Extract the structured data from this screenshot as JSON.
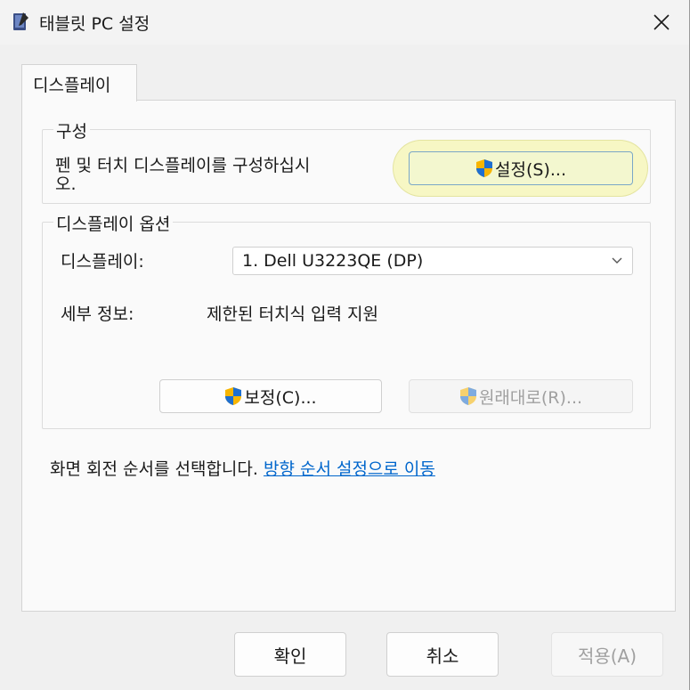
{
  "window": {
    "title": "태블릿 PC 설정",
    "icon": "tablet-pc-icon"
  },
  "tabs": [
    {
      "label": "디스플레이",
      "selected": true
    }
  ],
  "configure_group": {
    "label": "구성",
    "description_line1": "펜 및 터치 디스플레이를 구성하십시",
    "description_line2": "오.",
    "setup_button": {
      "label": "설정(S)...",
      "icon": "uac-shield-icon",
      "highlighted": true
    }
  },
  "display_options_group": {
    "label": "디스플레이 옵션",
    "display_label": "디스플레이:",
    "display_select_value": "1. Dell U3223QE (DP)",
    "details_label": "세부 정보:",
    "details_value": "제한된 터치식 입력 지원",
    "calibrate_button": {
      "label": "보정(C)...",
      "icon": "uac-shield-icon"
    },
    "reset_button": {
      "label": "원래대로(R)...",
      "icon": "uac-shield-icon",
      "enabled": false
    }
  },
  "rotation": {
    "text": "화면 회전 순서를 선택합니다.",
    "link": "방향 순서 설정으로 이동"
  },
  "footer": {
    "ok": "확인",
    "cancel": "취소",
    "apply": "적용(A)"
  },
  "colors": {
    "link": "#0066cc",
    "dialog_bg": "#f0f0f0",
    "panel_bg": "#fafafa",
    "highlight": "#f7f7c4"
  }
}
